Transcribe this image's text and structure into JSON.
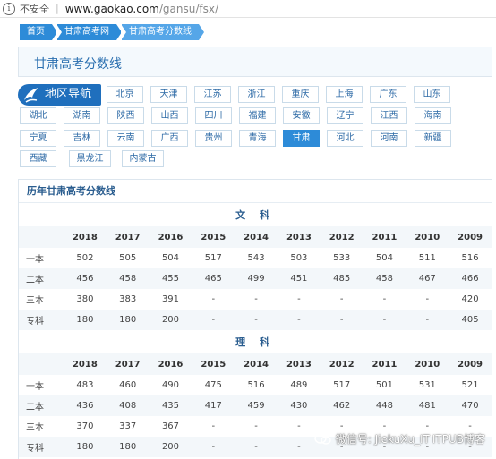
{
  "address_bar": {
    "security_label": "不安全",
    "url_host": "www.gaokao.com",
    "url_path": "/gansu/fsx/"
  },
  "breadcrumb": [
    "首页",
    "甘肃高考网",
    "甘肃高考分数线"
  ],
  "page_title": "甘肃高考分数线",
  "region_nav": {
    "logo_label": "地区导航",
    "rows": [
      [
        "北京",
        "天津",
        "江苏",
        "浙江",
        "重庆",
        "上海",
        "广东",
        "山东"
      ],
      [
        "湖北",
        "湖南",
        "陕西",
        "山西",
        "四川",
        "福建",
        "安徽",
        "辽宁",
        "江西",
        "海南"
      ],
      [
        "宁夏",
        "吉林",
        "云南",
        "广西",
        "贵州",
        "青海",
        "甘肃",
        "河北",
        "河南",
        "新疆"
      ],
      [
        "西藏",
        "黑龙江",
        "内蒙古"
      ]
    ],
    "active": "甘肃"
  },
  "scores": {
    "heading": "历年甘肃高考分数线",
    "years": [
      "2018",
      "2017",
      "2016",
      "2015",
      "2014",
      "2013",
      "2012",
      "2011",
      "2010",
      "2009"
    ],
    "sections": [
      {
        "title": "文 科",
        "rows": [
          {
            "label": "一本",
            "values": [
              "502",
              "505",
              "504",
              "517",
              "543",
              "503",
              "533",
              "504",
              "511",
              "516"
            ]
          },
          {
            "label": "二本",
            "values": [
              "456",
              "458",
              "455",
              "465",
              "499",
              "451",
              "485",
              "458",
              "467",
              "466"
            ]
          },
          {
            "label": "三本",
            "values": [
              "380",
              "383",
              "391",
              "-",
              "-",
              "-",
              "-",
              "-",
              "-",
              "420"
            ]
          },
          {
            "label": "专科",
            "values": [
              "180",
              "180",
              "200",
              "-",
              "-",
              "-",
              "-",
              "-",
              "-",
              "405"
            ]
          }
        ]
      },
      {
        "title": "理 科",
        "rows": [
          {
            "label": "一本",
            "values": [
              "483",
              "460",
              "490",
              "475",
              "516",
              "489",
              "517",
              "501",
              "531",
              "521"
            ]
          },
          {
            "label": "二本",
            "values": [
              "436",
              "408",
              "435",
              "417",
              "459",
              "430",
              "462",
              "448",
              "481",
              "470"
            ]
          },
          {
            "label": "三本",
            "values": [
              "370",
              "337",
              "367",
              "-",
              "-",
              "-",
              "-",
              "-",
              "-",
              "-"
            ]
          },
          {
            "label": "专科",
            "values": [
              "180",
              "180",
              "200",
              "-",
              "-",
              "-",
              "-",
              "-",
              "-",
              "-"
            ]
          }
        ]
      }
    ]
  },
  "watermark": {
    "line1": "微信号: JiekuXu_IT",
    "line2": "ITPUB博客"
  },
  "colors": {
    "accent": "#2d8bd8",
    "logo": "#1f6fbd",
    "title_text": "#2a6fb0"
  }
}
